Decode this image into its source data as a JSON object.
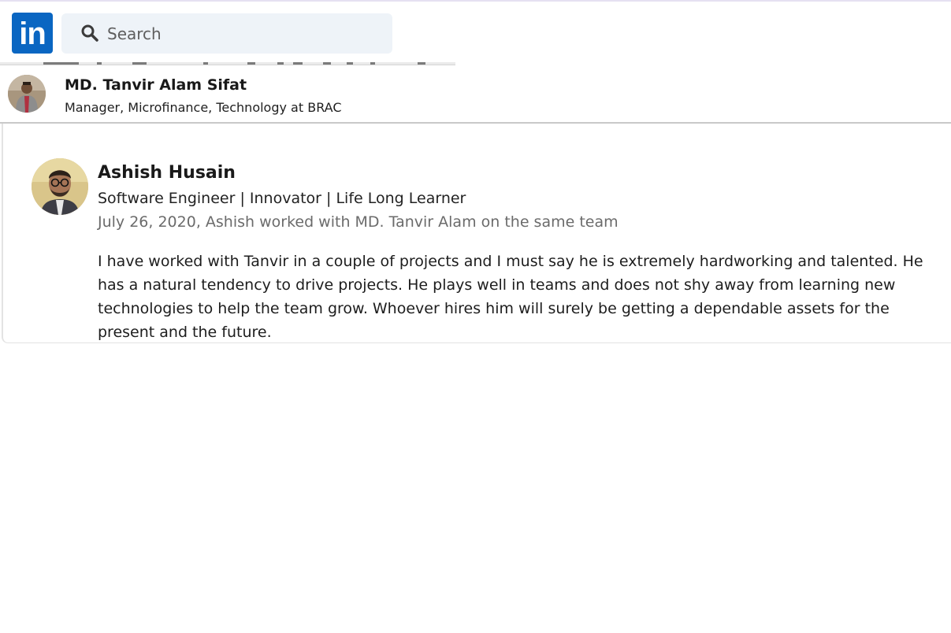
{
  "brand": {
    "logo_text": "in",
    "color": "#0a66c2"
  },
  "search": {
    "placeholder": "Search",
    "icon": "search-icon"
  },
  "profile": {
    "name": "MD. Tanvir Alam Sifat",
    "headline": "Manager, Microfinance, Technology at BRAC"
  },
  "recommendation": {
    "author_name": "Ashish Husain",
    "author_headline": "Software Engineer | Innovator | Life Long Learner",
    "meta": "July 26, 2020, Ashish worked with MD. Tanvir Alam on the same team",
    "text": "I have worked with Tanvir in a couple of projects and I must say he is extremely hardworking and talented. He has a natural tendency to drive projects. He plays well in teams and does not shy away from learning new technologies to help the team grow. Whoever hires him will surely be getting a dependable assets for the present and the future."
  }
}
